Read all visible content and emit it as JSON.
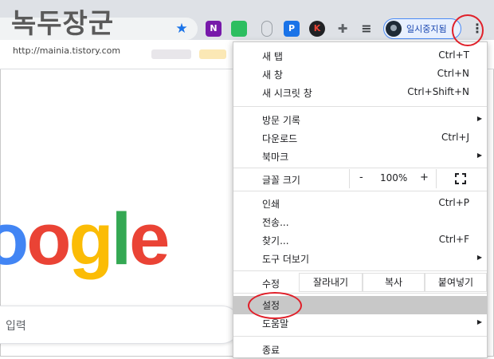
{
  "watermark": {
    "title": "녹두장군",
    "url": "http://mainia.tistory.com"
  },
  "toolbar": {
    "bookmark_icon": "star-icon",
    "extensions": [
      {
        "name": "onenote-icon",
        "glyph": "N",
        "color": "#7719aa"
      },
      {
        "name": "evernote-icon",
        "glyph": "●",
        "color": "#2dbe60"
      },
      {
        "name": "mouse-icon",
        "glyph": "🖱",
        "color": "#9aa0a6"
      },
      {
        "name": "document-download-icon",
        "glyph": "P",
        "color": "#1a73e8"
      },
      {
        "name": "k-icon",
        "glyph": "K",
        "color": "#202124"
      },
      {
        "name": "puzzle-icon",
        "glyph": "✚",
        "color": "#5f6368"
      },
      {
        "name": "media-queue-icon",
        "glyph": "≡",
        "color": "#3c4043"
      }
    ],
    "profile_name": "일시중지됨",
    "menu_icon": "more-vertical-icon",
    "menu_glyph": "⋮"
  },
  "page": {
    "logo_letters": [
      {
        "ch": "o",
        "color": "#4285f4"
      },
      {
        "ch": "o",
        "color": "#ea4335"
      },
      {
        "ch": "g",
        "color": "#fbbc05"
      },
      {
        "ch": "l",
        "color": "#34a853"
      },
      {
        "ch": "e",
        "color": "#ea4335"
      }
    ],
    "search_text": "입력"
  },
  "menu": {
    "items": [
      {
        "id": "new-tab",
        "label": "새 탭",
        "shortcut": "Ctrl+T"
      },
      {
        "id": "new-window",
        "label": "새 창",
        "shortcut": "Ctrl+N"
      },
      {
        "id": "new-incognito-window",
        "label": "새 시크릿 창",
        "shortcut": "Ctrl+Shift+N"
      },
      {
        "id": "history",
        "label": "방문 기록",
        "shortcut": ""
      },
      {
        "id": "downloads",
        "label": "다운로드",
        "shortcut": "Ctrl+J"
      },
      {
        "id": "bookmarks",
        "label": "북마크",
        "shortcut": ""
      },
      {
        "id": "print",
        "label": "인쇄",
        "shortcut": "Ctrl+P"
      },
      {
        "id": "cast",
        "label": "전송...",
        "shortcut": ""
      },
      {
        "id": "find",
        "label": "찾기...",
        "shortcut": "Ctrl+F"
      },
      {
        "id": "more-tools",
        "label": "도구 더보기",
        "shortcut": ""
      },
      {
        "id": "settings",
        "label": "설정",
        "shortcut": ""
      },
      {
        "id": "help",
        "label": "도움말",
        "shortcut": ""
      },
      {
        "id": "exit",
        "label": "종료",
        "shortcut": ""
      }
    ],
    "zoom": {
      "label": "글꼴 크기",
      "minus": "-",
      "value": "100%",
      "plus": "+",
      "fullscreen_icon": "fullscreen-icon"
    },
    "edit": {
      "label": "수정",
      "cut": "잘라내기",
      "copy": "복사",
      "paste": "붙여넣기"
    },
    "highlighted_item": "설정"
  },
  "colors": {
    "accent": "#1a73e8",
    "annotation": "#e0202a",
    "highlight": "#c8c8c8"
  }
}
